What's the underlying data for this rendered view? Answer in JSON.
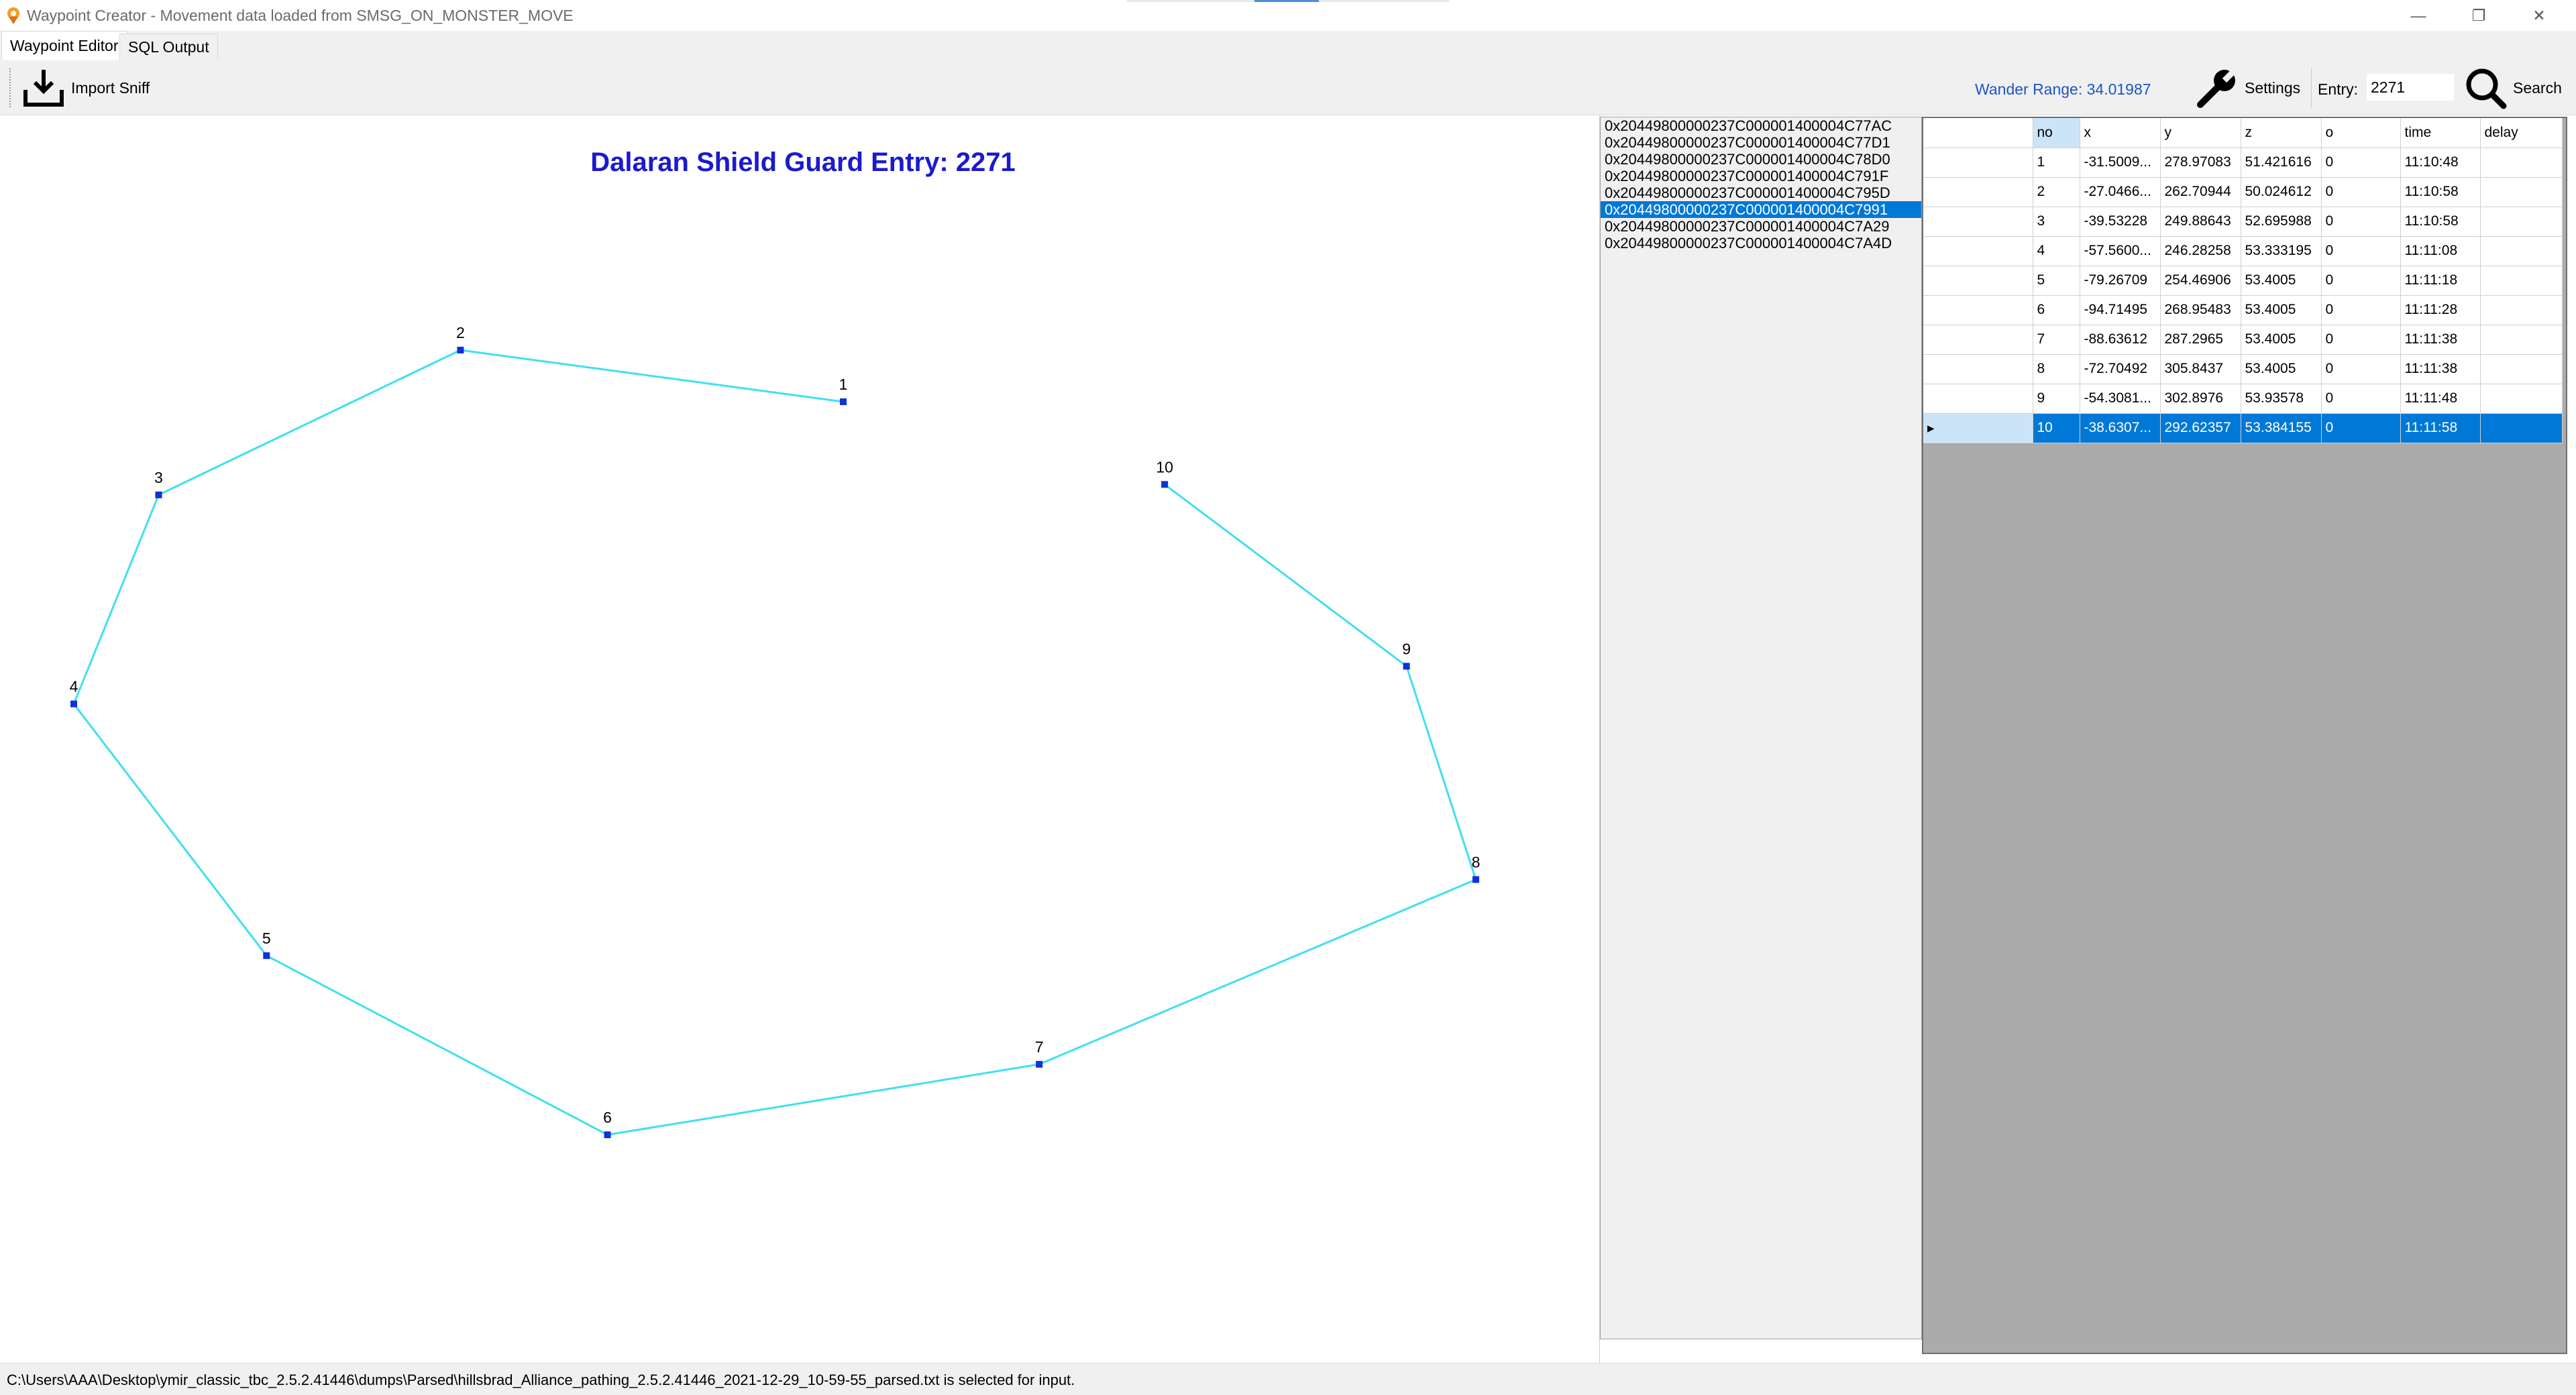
{
  "window": {
    "title": "Waypoint Creator - Movement data loaded from SMSG_ON_MONSTER_MOVE",
    "controls": {
      "minimize": "—",
      "restore": "❐",
      "close": "✕"
    }
  },
  "tabs": [
    {
      "label": "Waypoint Editor",
      "active": true
    },
    {
      "label": "SQL Output",
      "active": false
    }
  ],
  "toolbar": {
    "import_label": "Import Sniff",
    "wander_range": "Wander Range: 34.01987",
    "settings_label": "Settings",
    "entry_label": "Entry:",
    "entry_value": "2271",
    "search_label": "Search"
  },
  "canvas": {
    "title": "Dalaran Shield Guard Entry: 2271",
    "line_color": "#40e0f0",
    "point_color": "#1030e0",
    "title_color": "#1a1ad0"
  },
  "chart_data": {
    "type": "scatter",
    "title": "Dalaran Shield Guard Entry: 2271",
    "connected": true,
    "points": [
      {
        "label": "1",
        "x": -31.5009,
        "y": 278.97083
      },
      {
        "label": "2",
        "x": -27.0466,
        "y": 262.70944
      },
      {
        "label": "3",
        "x": -39.53228,
        "y": 249.88643
      },
      {
        "label": "4",
        "x": -57.56,
        "y": 246.28258
      },
      {
        "label": "5",
        "x": -79.26709,
        "y": 254.46906
      },
      {
        "label": "6",
        "x": -94.71495,
        "y": 268.95483
      },
      {
        "label": "7",
        "x": -88.63612,
        "y": 287.2965
      },
      {
        "label": "8",
        "x": -72.70492,
        "y": 305.8437
      },
      {
        "label": "9",
        "x": -54.3081,
        "y": 302.8976
      },
      {
        "label": "10",
        "x": -38.6307,
        "y": 292.62357
      }
    ]
  },
  "guid_list": {
    "items": [
      "0x20449800000237C000001400004C77AC",
      "0x20449800000237C000001400004C77D1",
      "0x20449800000237C000001400004C78D0",
      "0x20449800000237C000001400004C791F",
      "0x20449800000237C000001400004C795D",
      "0x20449800000237C000001400004C7991",
      "0x20449800000237C000001400004C7A29",
      "0x20449800000237C000001400004C7A4D"
    ],
    "selected_index": 5
  },
  "grid": {
    "columns": [
      "no",
      "x",
      "y",
      "z",
      "o",
      "time",
      "delay"
    ],
    "selected_column": "no",
    "rows": [
      [
        "1",
        "-31.5009...",
        "278.97083",
        "51.421616",
        "0",
        "11:10:48",
        ""
      ],
      [
        "2",
        "-27.0466...",
        "262.70944",
        "50.024612",
        "0",
        "11:10:58",
        ""
      ],
      [
        "3",
        "-39.53228",
        "249.88643",
        "52.695988",
        "0",
        "11:10:58",
        ""
      ],
      [
        "4",
        "-57.5600...",
        "246.28258",
        "53.333195",
        "0",
        "11:11:08",
        ""
      ],
      [
        "5",
        "-79.26709",
        "254.46906",
        "53.4005",
        "0",
        "11:11:18",
        ""
      ],
      [
        "6",
        "-94.71495",
        "268.95483",
        "53.4005",
        "0",
        "11:11:28",
        ""
      ],
      [
        "7",
        "-88.63612",
        "287.2965",
        "53.4005",
        "0",
        "11:11:38",
        ""
      ],
      [
        "8",
        "-72.70492",
        "305.8437",
        "53.4005",
        "0",
        "11:11:38",
        ""
      ],
      [
        "9",
        "-54.3081...",
        "302.8976",
        "53.93578",
        "0",
        "11:11:48",
        ""
      ],
      [
        "10",
        "-38.6307...",
        "292.62357",
        "53.384155",
        "0",
        "11:11:58",
        ""
      ]
    ],
    "selected_row": 9,
    "row_marker": "▸"
  },
  "status": {
    "text": "C:\\Users\\AAA\\Desktop\\ymir_classic_tbc_2.5.2.41446\\dumps\\Parsed\\hillsbrad_Alliance_pathing_2.5.2.41446_2021-12-29_10-59-55_parsed.txt is selected for input."
  },
  "icons": {
    "app": "waypoint-creator-app-icon",
    "import": "download-tray-icon",
    "settings": "wrench-icon",
    "search": "magnifier-icon"
  }
}
